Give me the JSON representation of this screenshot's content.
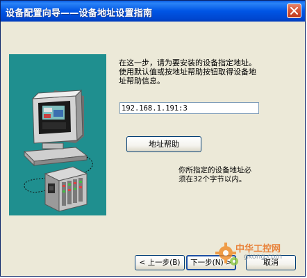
{
  "window": {
    "title": "设备配置向导——设备地址设置指南"
  },
  "instructions": {
    "line1": "在这一步，请为要安装的设备指定地址。",
    "line2": "使用默认值或按地址帮助按钮取得设备地",
    "line3": "址帮助信息。"
  },
  "address_field": {
    "value": "192.168.1.191:3"
  },
  "buttons": {
    "help": "地址帮助",
    "back": "< 上一步(B)",
    "next": "下一步(N) >",
    "cancel": "取消"
  },
  "note": {
    "line1": "你所指定的设备地址必",
    "line2": "须在32个字节以内。"
  },
  "watermark": {
    "top": "中华工控网",
    "bottom": "gkong.com"
  },
  "colors": {
    "titlebar": "#0055e5",
    "illustration_bg": "#1f8f8f",
    "dialog_bg": "#ece9d8"
  }
}
